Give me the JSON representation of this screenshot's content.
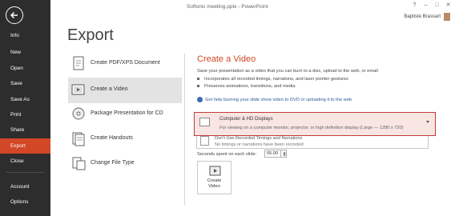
{
  "window": {
    "title": "Softonic meeting.pptx - PowerPoint",
    "controls": [
      "?",
      "–",
      "□",
      "✕"
    ],
    "user_name": "Baptiste Brassart"
  },
  "sidebar": {
    "items": [
      {
        "label": "Info"
      },
      {
        "label": "New"
      },
      {
        "label": "Open"
      },
      {
        "label": "Save"
      },
      {
        "label": "Save As"
      },
      {
        "label": "Print"
      },
      {
        "label": "Share"
      },
      {
        "label": "Export"
      },
      {
        "label": "Close"
      },
      {
        "label": "Account"
      },
      {
        "label": "Options"
      }
    ],
    "active": "Export",
    "active_color": "#d24726"
  },
  "page": {
    "title": "Export"
  },
  "options": [
    {
      "label": "Create PDF/XPS Document"
    },
    {
      "label": "Create a Video"
    },
    {
      "label": "Package Presentation for CD"
    },
    {
      "label": "Create Handouts"
    },
    {
      "label": "Change File Type"
    }
  ],
  "panel": {
    "title": "Create a Video",
    "description": "Save your presentation as a video that you can burn to a disc, upload to the web, or email",
    "bullets": [
      "Incorporates all recorded timings, narrations, and laser pointer gestures",
      "Preserves animations, transitions, and media"
    ],
    "help_link": "Get help burning your slide show video to DVD or uploading it to the web",
    "quality_dropdown": {
      "title": "Computer & HD Displays",
      "subtitle": "For viewing on a computer monitor, projector, or high definition display  (Large — 1280 x 720)"
    },
    "timings_dropdown": {
      "title": "Don't Use Recorded Timings and Narrations",
      "subtitle": "No timings or narrations have been recorded"
    },
    "seconds_label": "Seconds spent on each slide:",
    "seconds_value": "05.00",
    "create_button": {
      "line1": "Create",
      "line2": "Video"
    }
  }
}
